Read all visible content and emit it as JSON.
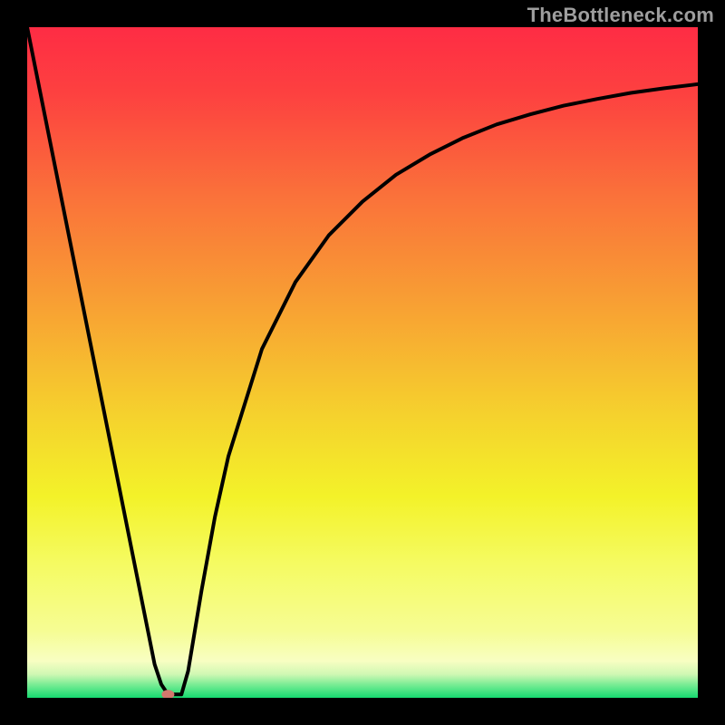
{
  "watermark": "TheBottleneck.com",
  "chart_data": {
    "type": "line",
    "title": "",
    "xlabel": "",
    "ylabel": "",
    "xlim": [
      0,
      100
    ],
    "ylim": [
      0,
      100
    ],
    "x": [
      0,
      4,
      8,
      12,
      16,
      18,
      19,
      20,
      21,
      22,
      23,
      24,
      25,
      26,
      28,
      30,
      35,
      40,
      45,
      50,
      55,
      60,
      65,
      70,
      75,
      80,
      85,
      90,
      95,
      100
    ],
    "y": [
      100,
      80,
      60,
      40,
      20,
      10,
      5,
      2,
      0.5,
      0.5,
      0.5,
      4,
      10,
      16,
      27,
      36,
      52,
      62,
      69,
      74,
      78,
      81,
      83.5,
      85.5,
      87,
      88.3,
      89.3,
      90.2,
      90.9,
      91.5
    ],
    "marker": {
      "x": 21,
      "y": 0.5,
      "color": "#d2786d"
    },
    "gradient_stops": [
      {
        "offset": 0.0,
        "color": "#fe2c44"
      },
      {
        "offset": 0.1,
        "color": "#fd4140"
      },
      {
        "offset": 0.25,
        "color": "#fa713a"
      },
      {
        "offset": 0.42,
        "color": "#f8a233"
      },
      {
        "offset": 0.58,
        "color": "#f5d22d"
      },
      {
        "offset": 0.7,
        "color": "#f3f229"
      },
      {
        "offset": 0.8,
        "color": "#f5fb62"
      },
      {
        "offset": 0.9,
        "color": "#f6fd93"
      },
      {
        "offset": 0.945,
        "color": "#f8fec2"
      },
      {
        "offset": 0.965,
        "color": "#cff8b3"
      },
      {
        "offset": 0.982,
        "color": "#70eb91"
      },
      {
        "offset": 1.0,
        "color": "#16da70"
      }
    ],
    "series": [
      {
        "name": "curve",
        "stroke": "#000000",
        "stroke_width": 4
      }
    ],
    "legend": false,
    "grid": false
  }
}
